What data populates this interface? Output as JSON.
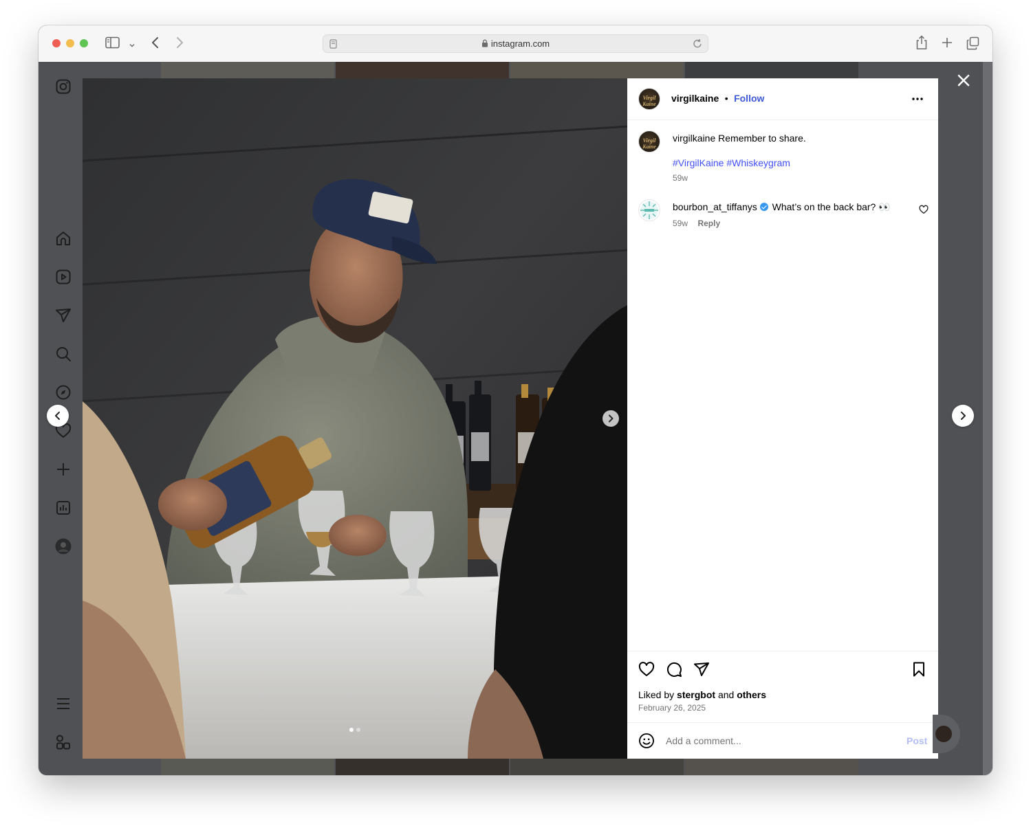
{
  "browser": {
    "url": "instagram.com"
  },
  "post": {
    "author": "virgilkaine",
    "follow_label": "Follow",
    "avatar_text": "Virgil Kaine",
    "caption_text": "Remember to share.",
    "hashtags": "#VirgilKaine #Whiskeygram",
    "caption_age": "59w",
    "liked_by_prefix": "Liked by",
    "liked_by_user": "stergbot",
    "liked_by_and": "and",
    "liked_by_others": "others",
    "date": "February 26, 2025"
  },
  "comments": [
    {
      "user": "bourbon_at_tiffanys",
      "verified": true,
      "text": "What’s on the back bar? 👀",
      "age": "59w",
      "reply_label": "Reply"
    }
  ],
  "comment_input": {
    "placeholder": "Add a comment...",
    "post_label": "Post"
  },
  "carousel": {
    "current": 1,
    "total": 2
  },
  "colors": {
    "accent": "#4150f7",
    "verified": "#3897f0",
    "overlay": "#4f5154"
  }
}
